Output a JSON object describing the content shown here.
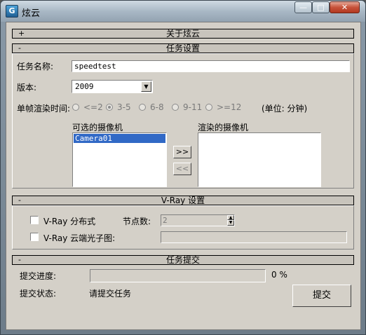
{
  "window": {
    "title": "炫云",
    "icon_letter": "G",
    "min_glyph": "—",
    "max_glyph": "□",
    "close_glyph": "✕"
  },
  "rollouts": {
    "about": {
      "sign": "+",
      "title": "关于炫云"
    },
    "task": {
      "sign": "-",
      "title": "任务设置"
    },
    "vray": {
      "sign": "-",
      "title": "V-Ray 设置"
    },
    "submit": {
      "sign": "-",
      "title": "任务提交"
    }
  },
  "task": {
    "name_label": "任务名称:",
    "name_value": "speedtest",
    "version_label": "版本:",
    "version_value": "2009",
    "frame_time_label": "单帧渲染时间:",
    "frame_time_options": [
      "<=2",
      "3-5",
      "6-8",
      "9-11",
      ">=12"
    ],
    "frame_time_selected": 1,
    "unit_label": "(单位: 分钟)",
    "available_cameras_label": "可选的摄像机",
    "available_cameras": [
      "Camera01"
    ],
    "render_cameras_label": "渲染的摄像机",
    "add_label": ">>",
    "remove_label": "<<"
  },
  "vray": {
    "distributed_label": "V-Ray 分布式",
    "nodes_label": "节点数:",
    "nodes_value": "2",
    "cloud_photon_label": "V-Ray 云端光子图:",
    "cloud_photon_value": ""
  },
  "submit": {
    "progress_label": "提交进度:",
    "progress_value": 0,
    "progress_text": "0 %",
    "status_label": "提交状态:",
    "status_value": "请提交任务",
    "submit_label": "提交"
  },
  "colors": {
    "selection": "#3169c6",
    "panel": "#d4d0c8",
    "close_button": "#c7523a"
  }
}
